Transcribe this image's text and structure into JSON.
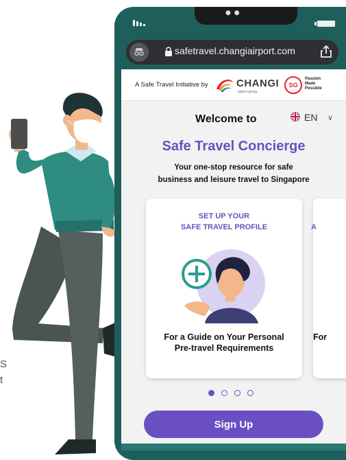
{
  "browser": {
    "url": "safetravel.changiairport.com"
  },
  "header": {
    "initiative_text": "A Safe Travel Initiative by",
    "changi_name": "CHANGI",
    "changi_sub": "airport group",
    "sg_badge": "SG",
    "passion_line1": "Passion",
    "passion_line2": "Made",
    "passion_line3": "Possible"
  },
  "language": {
    "selected": "EN"
  },
  "main": {
    "welcome": "Welcome to",
    "headline": "Safe Travel Concierge",
    "subtitle_line1": "Your one-stop resource for safe",
    "subtitle_line2": "business and leisure travel to Singapore"
  },
  "cards": [
    {
      "title_line1": "SET UP YOUR",
      "title_line2": "SAFE TRAVEL PROFILE",
      "desc_line1": "For a Guide on Your Personal",
      "desc_line2": "Pre-travel Requirements"
    },
    {
      "title_partial": "A",
      "desc_partial": "For"
    }
  ],
  "carousel": {
    "total": 4,
    "active_index": 0
  },
  "actions": {
    "signup_label": "Sign Up"
  },
  "side_text": {
    "line1": "S",
    "line2": "t"
  },
  "colors": {
    "accent": "#6a4fc2",
    "phone_frame": "#1f5f5b",
    "sweater": "#2f8c80"
  }
}
